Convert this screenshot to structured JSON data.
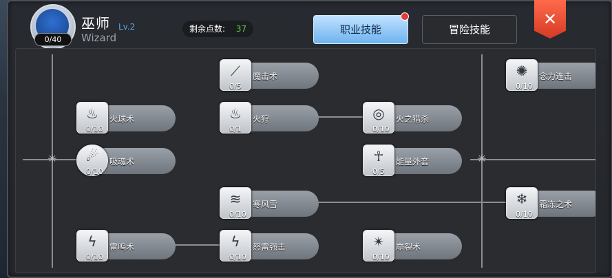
{
  "header": {
    "class_cn": "巫师",
    "level": "Lv.2",
    "class_en": "Wizard",
    "avatar_level": "0/40",
    "points_label": "剩余点数:",
    "points_value": "37",
    "tab_job": "职业技能",
    "tab_adventure": "冒险技能",
    "close_symbol": "✕"
  },
  "skills": [
    {
      "name": "魔击术",
      "count": "0/5",
      "icon": "slash-icon"
    },
    {
      "name": "念力连击",
      "count": "0/10",
      "icon": "multi-orb-icon"
    },
    {
      "name": "火球术",
      "count": "0/10",
      "icon": "fire-icon"
    },
    {
      "name": "火狩",
      "count": "0/1",
      "icon": "fire-hunt-icon"
    },
    {
      "name": "火之猎杀",
      "count": "0/10",
      "icon": "fire-ring-icon"
    },
    {
      "name": "吸魂术",
      "count": "0/10",
      "icon": "soul-icon"
    },
    {
      "name": "能量外套",
      "count": "0/5",
      "icon": "energy-coat-icon"
    },
    {
      "name": "寒风雪",
      "count": "0/10",
      "icon": "blizzard-icon"
    },
    {
      "name": "霜冻之术",
      "count": "0/10",
      "icon": "frost-icon"
    },
    {
      "name": "雷鸣术",
      "count": "0/10",
      "icon": "thunder-icon"
    },
    {
      "name": "怒雷强击",
      "count": "0/10",
      "icon": "thunder-strike-icon"
    },
    {
      "name": "崩裂术",
      "count": "0/10",
      "icon": "burst-icon"
    }
  ],
  "colors": {
    "accent_blue": "#6fb3ef",
    "points_green": "#63c94b",
    "close_red": "#d53a25",
    "notification_red": "#e63a3a"
  }
}
